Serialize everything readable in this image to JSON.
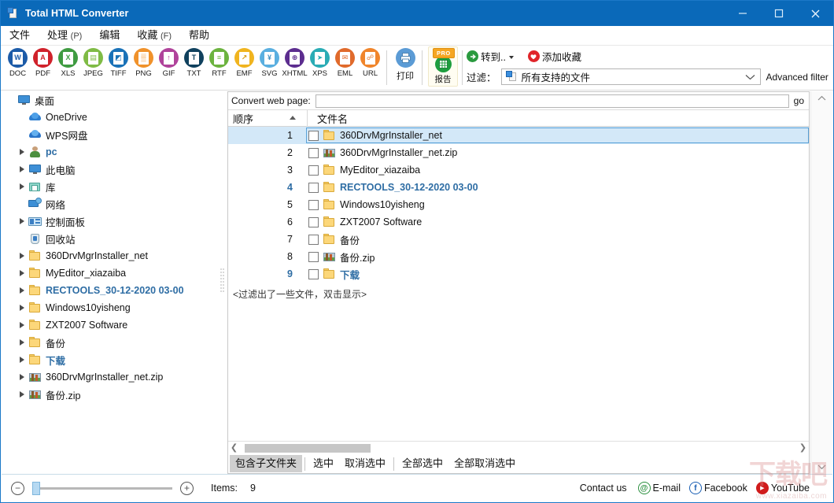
{
  "window": {
    "title": "Total HTML Converter",
    "icon": "app-document-icon",
    "titlebar_color": "#0a69b9",
    "minimize": "—",
    "maximize": "□",
    "close": "✕"
  },
  "menubar": {
    "items": [
      {
        "label": "文件",
        "mnemonic": ""
      },
      {
        "label": "处理",
        "mnemonic": "(P)"
      },
      {
        "label": "编辑",
        "mnemonic": ""
      },
      {
        "label": "收藏",
        "mnemonic": "(F)"
      },
      {
        "label": "帮助",
        "mnemonic": ""
      }
    ]
  },
  "toolbar": {
    "formats": [
      {
        "label": "DOC",
        "glyph": "W",
        "color": "#1c5ba8",
        "glyph_color": "#1c5ba8"
      },
      {
        "label": "PDF",
        "glyph": "A",
        "color": "#d0222b",
        "glyph_color": "#d0222b"
      },
      {
        "label": "XLS",
        "glyph": "X",
        "color": "#3f9b41",
        "glyph_color": "#3f9b41"
      },
      {
        "label": "JPEG",
        "glyph": "▤",
        "color": "#7fbb45",
        "glyph_color": "#7fbb45"
      },
      {
        "label": "TIFF",
        "glyph": "◩",
        "color": "#1a72b8",
        "glyph_color": "#1a72b8"
      },
      {
        "label": "PNG",
        "glyph": "▒",
        "color": "#f0922b",
        "glyph_color": "#f0922b"
      },
      {
        "label": "GIF",
        "glyph": "↑",
        "color": "#b0439b",
        "glyph_color": "#b0439b"
      },
      {
        "label": "TXT",
        "glyph": "T",
        "color": "#10415e",
        "glyph_color": "#10415e"
      },
      {
        "label": "RTF",
        "glyph": "≡",
        "color": "#6cb33f",
        "glyph_color": "#6cb33f"
      },
      {
        "label": "EMF",
        "glyph": "↗",
        "color": "#f0b41f",
        "glyph_color": "#d89a10"
      },
      {
        "label": "SVG",
        "glyph": "¥",
        "color": "#5aafe0",
        "glyph_color": "#3f8fc0"
      },
      {
        "label": "XHTML",
        "glyph": "⊕",
        "color": "#5c2d8f",
        "glyph_color": "#5c2d8f"
      },
      {
        "label": "XPS",
        "glyph": "➤",
        "color": "#2aacb5",
        "glyph_color": "#2aacb5"
      },
      {
        "label": "EML",
        "glyph": "✉",
        "color": "#e06a2b",
        "glyph_color": "#e06a2b"
      },
      {
        "label": "URL",
        "glyph": "☍",
        "color": "#f0852b",
        "glyph_color": "#e0762b"
      }
    ],
    "print": {
      "label": "打印",
      "icon": "printer-icon",
      "color": "#5b9bd5"
    },
    "report": {
      "label": "报告",
      "badge": "PRO",
      "icon": "report-grid-icon",
      "color": "#1e9e3e"
    },
    "goto": {
      "label": "转到..",
      "icon": "goto-arrow-icon",
      "color": "#2a9a3f"
    },
    "add_favorite": {
      "label": "添加收藏",
      "icon": "heart-icon",
      "color": "#e0252a"
    },
    "filter": {
      "label": "过滤：",
      "value": "所有支持的文件",
      "icon": "file-types-icon"
    },
    "advanced_filter": "Advanced filter"
  },
  "tree": {
    "items": [
      {
        "label": "桌面",
        "icon": "desktop-icon",
        "expander": false,
        "indent": 0,
        "style": "normal"
      },
      {
        "label": "OneDrive",
        "icon": "onedrive-cloud-icon",
        "expander": false,
        "indent": 1,
        "style": "normal"
      },
      {
        "label": "WPS网盘",
        "icon": "wps-cloud-icon",
        "expander": false,
        "indent": 1,
        "style": "normal"
      },
      {
        "label": "pc",
        "icon": "user-icon",
        "expander": true,
        "indent": 1,
        "style": "blue"
      },
      {
        "label": "此电脑",
        "icon": "this-pc-icon",
        "expander": true,
        "indent": 1,
        "style": "normal"
      },
      {
        "label": "库",
        "icon": "library-icon",
        "expander": true,
        "indent": 1,
        "style": "normal"
      },
      {
        "label": "网络",
        "icon": "network-icon",
        "expander": false,
        "indent": 1,
        "style": "normal"
      },
      {
        "label": "控制面板",
        "icon": "control-panel-icon",
        "expander": true,
        "indent": 1,
        "style": "normal"
      },
      {
        "label": "回收站",
        "icon": "recycle-bin-icon",
        "expander": false,
        "indent": 1,
        "style": "normal"
      },
      {
        "label": "360DrvMgrInstaller_net",
        "icon": "folder-icon",
        "expander": true,
        "indent": 1,
        "style": "normal"
      },
      {
        "label": "MyEditor_xiazaiba",
        "icon": "folder-icon",
        "expander": true,
        "indent": 1,
        "style": "normal"
      },
      {
        "label": "RECTOOLS_30-12-2020 03-00",
        "icon": "folder-icon",
        "expander": true,
        "indent": 1,
        "style": "blue"
      },
      {
        "label": "Windows10yisheng",
        "icon": "folder-icon",
        "expander": true,
        "indent": 1,
        "style": "normal"
      },
      {
        "label": "ZXT2007 Software",
        "icon": "folder-icon",
        "expander": true,
        "indent": 1,
        "style": "normal"
      },
      {
        "label": "备份",
        "icon": "folder-icon",
        "expander": true,
        "indent": 1,
        "style": "normal"
      },
      {
        "label": "下载",
        "icon": "folder-icon",
        "expander": true,
        "indent": 1,
        "style": "blue"
      },
      {
        "label": "360DrvMgrInstaller_net.zip",
        "icon": "zip-icon",
        "expander": true,
        "indent": 1,
        "style": "normal"
      },
      {
        "label": "备份.zip",
        "icon": "zip-icon",
        "expander": true,
        "indent": 1,
        "style": "normal"
      }
    ]
  },
  "filepanel": {
    "web_page": {
      "label": "Convert web page:",
      "value": "",
      "placeholder": "",
      "go_label": "go"
    },
    "columns": [
      {
        "key": "order",
        "label": "顺序",
        "sorted": "asc"
      },
      {
        "key": "name",
        "label": "文件名",
        "sorted": ""
      }
    ],
    "rows": [
      {
        "num": "1",
        "name": "360DrvMgrInstaller_net",
        "icon": "folder-icon",
        "checked": false,
        "selected": true,
        "style": "normal"
      },
      {
        "num": "2",
        "name": "360DrvMgrInstaller_net.zip",
        "icon": "zip-icon",
        "checked": false,
        "selected": false,
        "style": "normal"
      },
      {
        "num": "3",
        "name": "MyEditor_xiazaiba",
        "icon": "folder-icon",
        "checked": false,
        "selected": false,
        "style": "normal"
      },
      {
        "num": "4",
        "name": "RECTOOLS_30-12-2020 03-00",
        "icon": "folder-icon",
        "checked": false,
        "selected": false,
        "style": "blue"
      },
      {
        "num": "5",
        "name": "Windows10yisheng",
        "icon": "folder-icon",
        "checked": false,
        "selected": false,
        "style": "normal"
      },
      {
        "num": "6",
        "name": "ZXT2007 Software",
        "icon": "folder-icon",
        "checked": false,
        "selected": false,
        "style": "normal"
      },
      {
        "num": "7",
        "name": "备份",
        "icon": "folder-icon",
        "checked": false,
        "selected": false,
        "style": "normal"
      },
      {
        "num": "8",
        "name": "备份.zip",
        "icon": "zip-icon",
        "checked": false,
        "selected": false,
        "style": "normal"
      },
      {
        "num": "9",
        "name": "下载",
        "icon": "folder-icon",
        "checked": false,
        "selected": false,
        "style": "blue"
      }
    ],
    "filter_note": "<过滤出了一些文件，双击显示>",
    "buttons": [
      {
        "label": "包含子文件夹",
        "active": true
      },
      {
        "label": "选中",
        "active": false
      },
      {
        "label": "取消选中",
        "active": false
      },
      {
        "label": "全部选中",
        "active": false
      },
      {
        "label": "全部取消选中",
        "active": false
      }
    ]
  },
  "statusbar": {
    "zoom_out": "−",
    "zoom_in": "+",
    "items_label": "Items:",
    "items_count": "9",
    "contact_us": "Contact us",
    "links": [
      {
        "label": "E-mail",
        "icon": "email-at-icon",
        "glyph": "@",
        "color": "#2a8f3e"
      },
      {
        "label": "Facebook",
        "icon": "facebook-icon",
        "glyph": "f",
        "color": "#1a5fb4"
      },
      {
        "label": "YouTube",
        "icon": "youtube-icon",
        "glyph": "▶",
        "color": "#d01b1b"
      }
    ]
  },
  "watermark": {
    "text": "下载吧",
    "url": "www.xiazaiba.com"
  }
}
